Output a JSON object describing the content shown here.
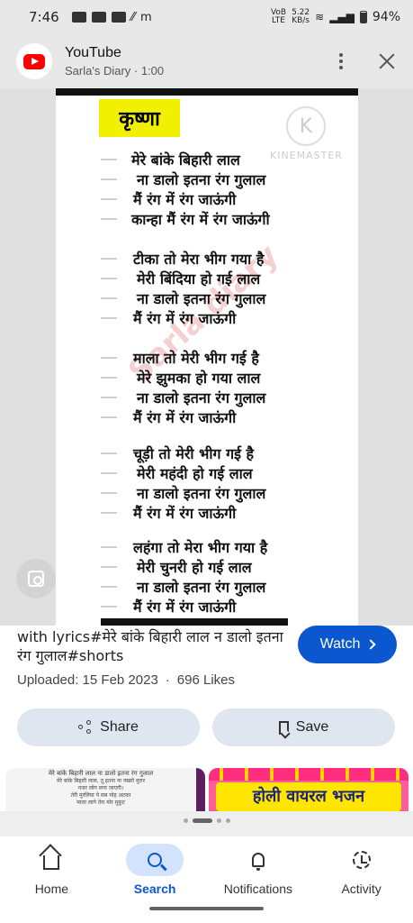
{
  "status": {
    "time": "7:46",
    "left_icons": [
      "notification-icon",
      "youtube-icon",
      "youtube-icon",
      "missed-call-icon",
      "m-icon"
    ],
    "volte": "VoB\nLTE",
    "speed": "5.22\nKB/s",
    "battery": "94%"
  },
  "header": {
    "title": "YouTube",
    "subtitle": "Sarla's Diary · 1:00"
  },
  "video": {
    "heading": "कृष्णा",
    "watermark_logo": "K",
    "watermark_text": "KINEMASTER",
    "faint_watermark": "Sarla diary",
    "lines": [
      "मेरे बांके बिहारी लाल",
      "ना डालो इतना रंग गुलाल",
      "मैं रंग में रंग जाऊंगी",
      "कान्हा मैं रंग में रंग जाऊंगी",
      "टीका तो मेरा भीग गया है",
      "मेरी बिंदिया हो गई लाल",
      "ना डालो इतना रंग गुलाल",
      "मैं रंग में रंग जाऊंगी",
      "माला तो मेरी भीग गई है",
      "मेरे झुमका हो गया लाल",
      "ना डालो इतना रंग गुलाल",
      "मैं रंग में रंग जाऊंगी",
      "चूड़ी तो मेरी भीग गई है",
      "मेरी महंदी हो गई लाल",
      "ना डालो इतना रंग गुलाल",
      "मैं रंग में रंग जाऊंगी",
      "लहंगा तो मेरा भीग गया है",
      "मेरी चुनरी हो गई लाल",
      "ना डालो इतना रंग गुलाल",
      "मैं रंग में रंग जाऊंगी"
    ]
  },
  "info": {
    "title": "with lyrics#मेरे बांके बिहारी लाल न डालो इतना रंग गुलाल#shorts",
    "watch_label": "Watch",
    "uploaded": "Uploaded: 15 Feb 2023",
    "separator": "·",
    "likes": "696 Likes",
    "share_label": "Share",
    "save_label": "Save",
    "thumb1_heading": "मेरे बांके बिहारी लाल ना डालो इतना रंग गुलाल",
    "thumb1_lines": "मेरे बांके बिहारी लाल, तू इतना ना नखरो मुरार\nनजर लोग लगा जाएगी।\nतेरी मुरलिया पे सब मोह अटका\nप्यारा लागे तेरा मोर मुकुट",
    "thumb2_title": "होली वायरल भजन"
  },
  "nav": {
    "home": "Home",
    "search": "Search",
    "notifications": "Notifications",
    "activity": "Activity"
  },
  "colors": {
    "accent": "#0b57d0",
    "youtube_red": "#ff0000",
    "heading_yellow": "#f0f000"
  }
}
